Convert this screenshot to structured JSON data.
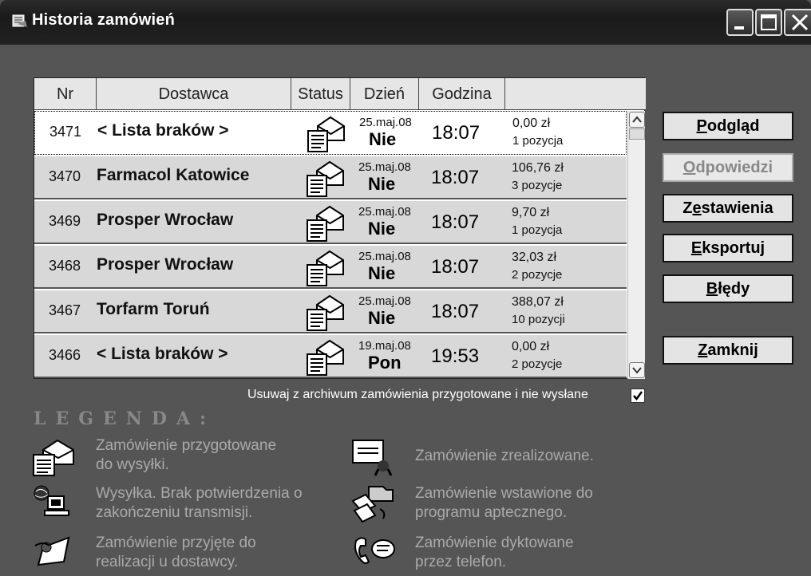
{
  "window": {
    "title": "Historia zamówień"
  },
  "table": {
    "headers": [
      "Nr",
      "Dostawca",
      "Status",
      "Dzień",
      "Godzina",
      ""
    ],
    "rows": [
      {
        "nr": "3471",
        "supplier": "< Lista braków >",
        "date": "25.maj.08",
        "day": "Nie",
        "time": "18:07",
        "amount": "0,00 zł",
        "positions": "1 pozycja"
      },
      {
        "nr": "3470",
        "supplier": "Farmacol Katowice",
        "date": "25.maj.08",
        "day": "Nie",
        "time": "18:07",
        "amount": "106,76 zł",
        "positions": "3 pozycje"
      },
      {
        "nr": "3469",
        "supplier": "Prosper Wrocław",
        "date": "25.maj.08",
        "day": "Nie",
        "time": "18:07",
        "amount": "9,70 zł",
        "positions": "1 pozycja"
      },
      {
        "nr": "3468",
        "supplier": "Prosper Wrocław",
        "date": "25.maj.08",
        "day": "Nie",
        "time": "18:07",
        "amount": "32,03 zł",
        "positions": "2 pozycje"
      },
      {
        "nr": "3467",
        "supplier": "Torfarm Toruń",
        "date": "25.maj.08",
        "day": "Nie",
        "time": "18:07",
        "amount": "388,07 zł",
        "positions": "10 pozycji"
      },
      {
        "nr": "3466",
        "supplier": "< Lista braków >",
        "date": "19.maj.08",
        "day": "Pon",
        "time": "19:53",
        "amount": "0,00 zł",
        "positions": "2 pozycje"
      }
    ]
  },
  "buttons": {
    "podglad": {
      "pre": "",
      "ul": "P",
      "post": "odgląd"
    },
    "odpowiedzi": {
      "pre": "",
      "ul": "O",
      "post": "dpowiedzi"
    },
    "zestawienia": {
      "pre": "Z",
      "ul": "e",
      "post": "stawienia"
    },
    "eksportuj": {
      "pre": "",
      "ul": "E",
      "post": "ksportuj"
    },
    "bledy": {
      "pre": "",
      "ul": "B",
      "post": "łędy"
    },
    "zamknij": {
      "pre": "",
      "ul": "Z",
      "post": "amknij"
    }
  },
  "archive": {
    "label": "Usuwaj z archiwum zamówienia przygotowane i nie wysłane",
    "checked": true
  },
  "legend": {
    "title": "LEGENDA:",
    "items": [
      {
        "icon": "envelope-document-icon",
        "line1": "Zamówienie przygotowane",
        "line2": "do wysyłki."
      },
      {
        "icon": "certificate-icon",
        "line1": "Zamówienie zrealizowane.",
        "line2": ""
      },
      {
        "icon": "globe-computer-icon",
        "line1": "Wysyłka. Brak potwierdzenia o",
        "line2": "zakończeniu transmisji."
      },
      {
        "icon": "folder-transfer-icon",
        "line1": "Zamówienie wstawione do",
        "line2": "programu aptecznego."
      },
      {
        "icon": "accepted-document-icon",
        "line1": "Zamówienie przyjęte do",
        "line2": "realizacji u dostawcy."
      },
      {
        "icon": "phone-speech-icon",
        "line1": "Zamówienie dyktowane",
        "line2": "przez telefon."
      }
    ]
  },
  "colors": {
    "background": "#555555",
    "titlebar": "#1a1a1a",
    "row": "#d8d8d8",
    "selected_row": "#ffffff"
  }
}
